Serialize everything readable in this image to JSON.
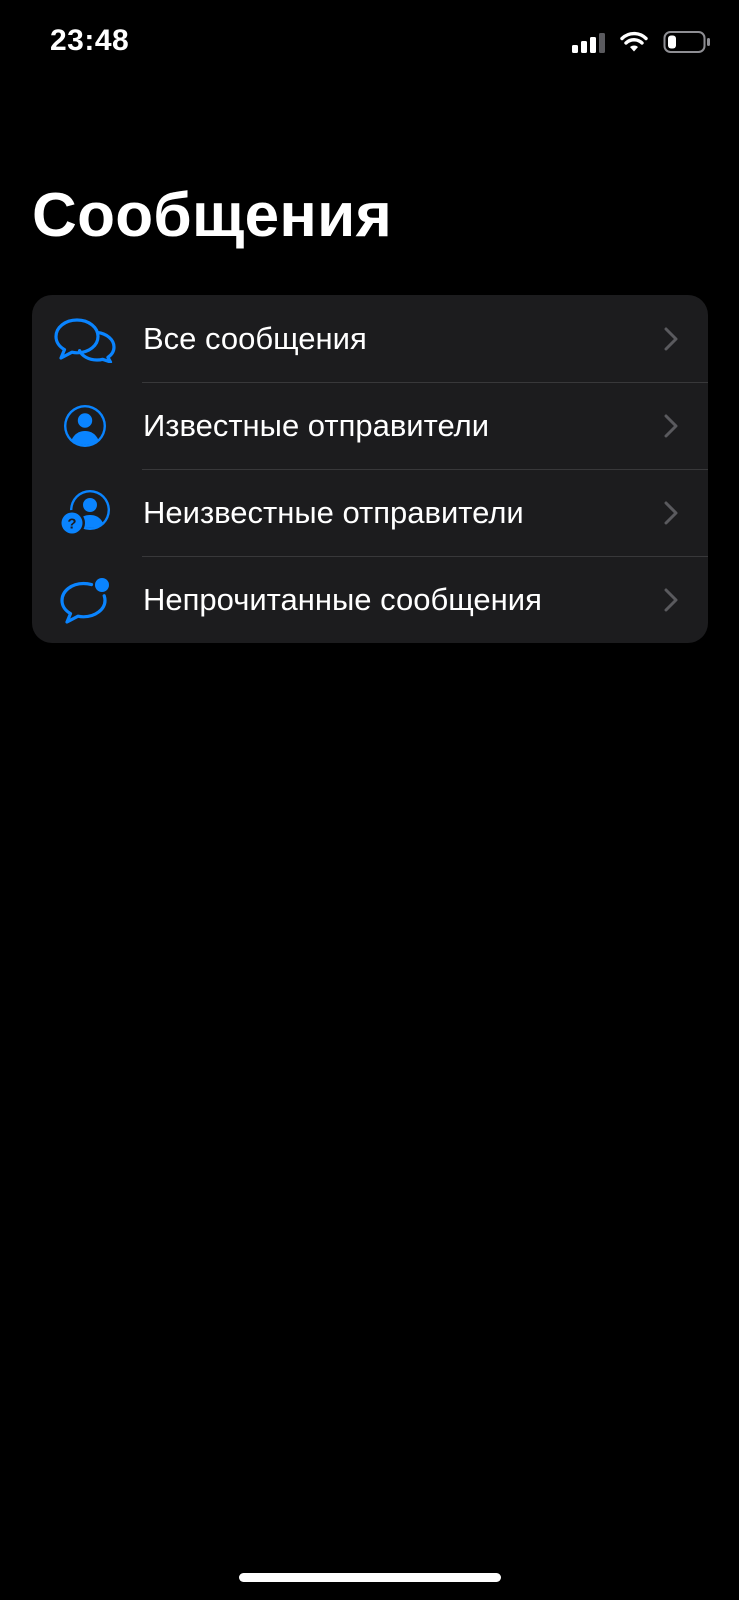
{
  "status_bar": {
    "time": "23:48",
    "signal_bars_active": 3,
    "signal_bars_total": 4,
    "battery_level": 0.25
  },
  "page": {
    "title": "Сообщения"
  },
  "filters": {
    "items": [
      {
        "label": "Все сообщения",
        "icon": "two-chat-bubbles-icon"
      },
      {
        "label": "Известные отправители",
        "icon": "person-circle-icon"
      },
      {
        "label": "Неизвестные отправители",
        "icon": "person-question-icon"
      },
      {
        "label": "Непрочитанные сообщения",
        "icon": "unread-bubble-icon"
      }
    ]
  },
  "colors": {
    "background": "#000000",
    "group_background": "#1c1c1e",
    "accent_blue": "#0a84ff",
    "chevron": "#5a5a5e",
    "separator": "#38383a"
  }
}
